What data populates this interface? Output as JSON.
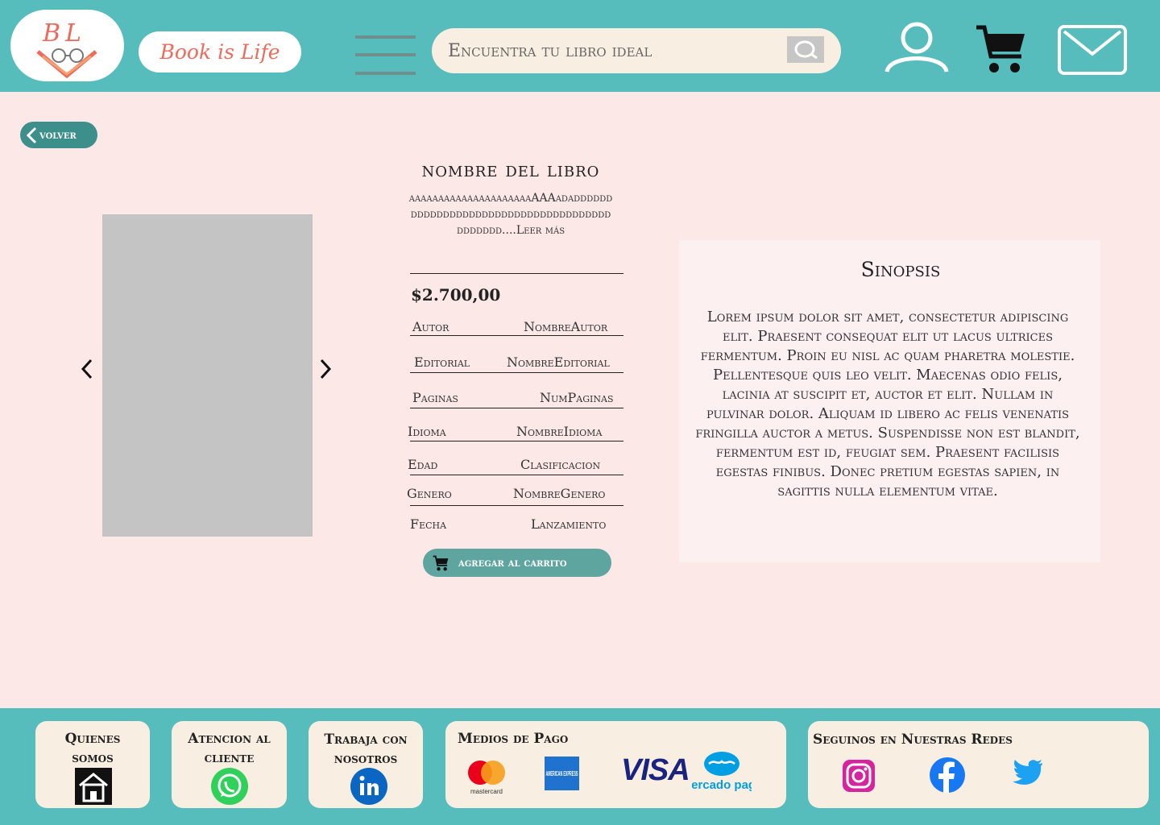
{
  "header": {
    "logo_letters": "BL",
    "brand": "Book is Life",
    "search_placeholder": "Encuentra tu libro ideal",
    "icons": [
      "menu-icon",
      "search-icon",
      "user-icon",
      "cart-icon",
      "mail-icon"
    ]
  },
  "back_label": "volver",
  "product": {
    "title": "nombre del libro",
    "description": "aaaaaaaaaaaaaaaaaaaaaAAAadadddddddddddddddddddddddddddddddddddddddddddd....Leer más",
    "price": "$2.700,00",
    "specs": [
      {
        "label": "Autor",
        "value": "NombreAutor"
      },
      {
        "label": "Editorial",
        "value": "NombreEditorial"
      },
      {
        "label": "Paginas",
        "value": "NumPaginas"
      },
      {
        "label": "Idioma",
        "value": "NombreIdioma"
      },
      {
        "label": "Edad",
        "value": "Clasificacion"
      },
      {
        "label": "Genero",
        "value": "NombreGenero"
      },
      {
        "label": "Fecha",
        "value": "Lanzamiento"
      }
    ],
    "add_to_cart": "agregar al carrito"
  },
  "synopsis": {
    "title": "Sinopsis",
    "text": "Lorem ipsum dolor sit amet, consectetur adipiscing elit. Praesent consequat elit ut lacus ultrices fermentum. Proin eu nisl ac quam pharetra molestie. Pellentesque quis leo velit. Maecenas odio felis, lacinia at suscipit et, auctor et elit. Nullam in pulvinar dolor. Aliquam id libero ac felis venenatis fringilla auctor a metus. Suspendisse non est blandit, fermentum est id, feugiat sem.  Praesent facilisis egestas finibus. Donec pretium egestas sapien, in sagittis nulla elementum vitae."
  },
  "footer": {
    "about": "Quienes somos",
    "support": "Atencion al cliente",
    "jobs": "Trabaja con nosotros",
    "payments_title": "Medios de Pago",
    "payments": [
      "mastercard",
      "AMERICAN EXPRESS",
      "VISA",
      "mercado pago"
    ],
    "social_title": "Seguinos en Nuestras Redes",
    "social": [
      "instagram-icon",
      "facebook-icon",
      "twitter-icon"
    ]
  },
  "colors": {
    "teal": "#56bcbc",
    "background": "#fde8e8",
    "cream": "#f8efe2",
    "brand_coral": "#ef6a5a",
    "button_teal": "#5ea5a0"
  }
}
